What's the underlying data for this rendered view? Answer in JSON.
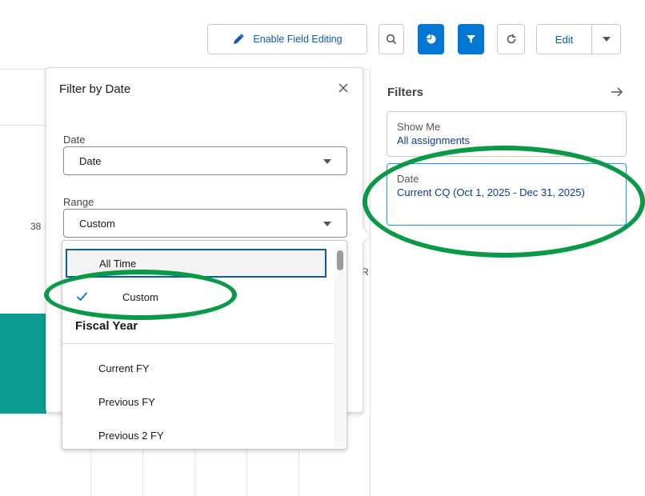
{
  "toolbar": {
    "enable_field_editing": "Enable Field Editing",
    "edit_label": "Edit"
  },
  "report": {
    "side_number": "38",
    "side_letter": "R"
  },
  "popover": {
    "title": "Filter by Date",
    "date_label": "Date",
    "date_value": "Date",
    "range_label": "Range",
    "range_value": "Custom"
  },
  "dropdown": {
    "option_all_time": "All Time",
    "option_custom": "Custom",
    "group_fiscal_year": "Fiscal Year",
    "fiscal_options": [
      "Current FY",
      "Previous FY",
      "Previous 2 FY"
    ]
  },
  "filters": {
    "title": "Filters",
    "show_me_label": "Show Me",
    "show_me_value": "All assignments",
    "date_label": "Date",
    "date_value": "Current CQ (Oct 1, 2025 - Dec 31, 2025)"
  },
  "colors": {
    "brand_blue": "#0176d3",
    "link_blue": "#0b5cab",
    "teal_bar": "#0d9d91",
    "highlight_green": "#0a9a47"
  }
}
